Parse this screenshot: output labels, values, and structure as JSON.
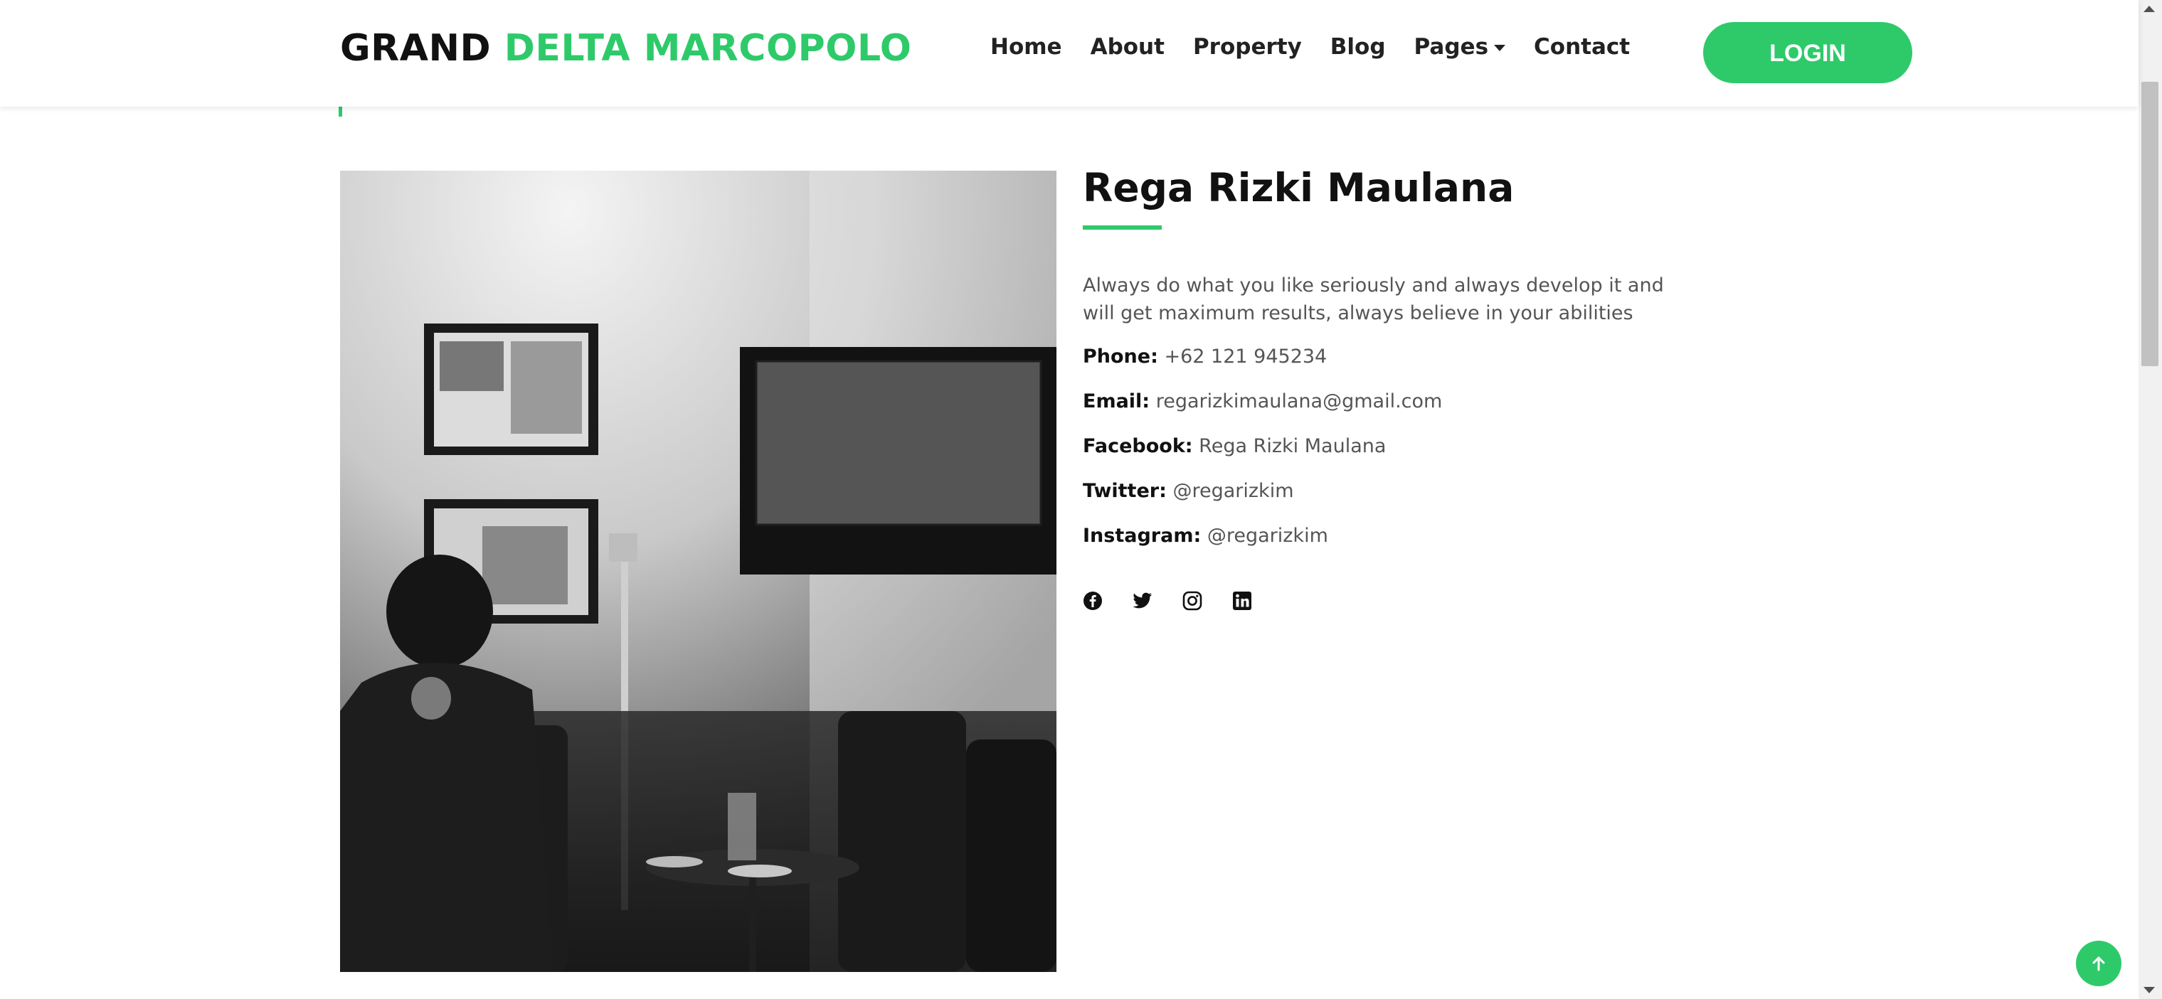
{
  "brand": {
    "part1": "GRAND",
    "part2": "DELTA MARCOPOLO"
  },
  "nav": {
    "items": [
      "Home",
      "About",
      "Property",
      "Blog",
      "Pages",
      "Contact"
    ]
  },
  "login_label": "LOGIN",
  "agent": {
    "name": "Rega Rizki Maulana",
    "bio": "Always do what you like seriously and always develop it and will get maximum results, always believe in your abilities",
    "contacts": [
      {
        "label": "Phone:",
        "value": "+62 121 945234"
      },
      {
        "label": "Email:",
        "value": "regarizkimaulana@gmail.com"
      },
      {
        "label": "Facebook:",
        "value": "Rega Rizki Maulana"
      },
      {
        "label": "Twitter:",
        "value": "@regarizkim"
      },
      {
        "label": "Instagram:",
        "value": "@regarizkim"
      }
    ],
    "social_icons": [
      "facebook-icon",
      "twitter-icon",
      "instagram-icon",
      "linkedin-icon"
    ]
  },
  "colors": {
    "accent": "#2eca6a",
    "text_dark": "#111111",
    "text_muted": "#555555"
  }
}
